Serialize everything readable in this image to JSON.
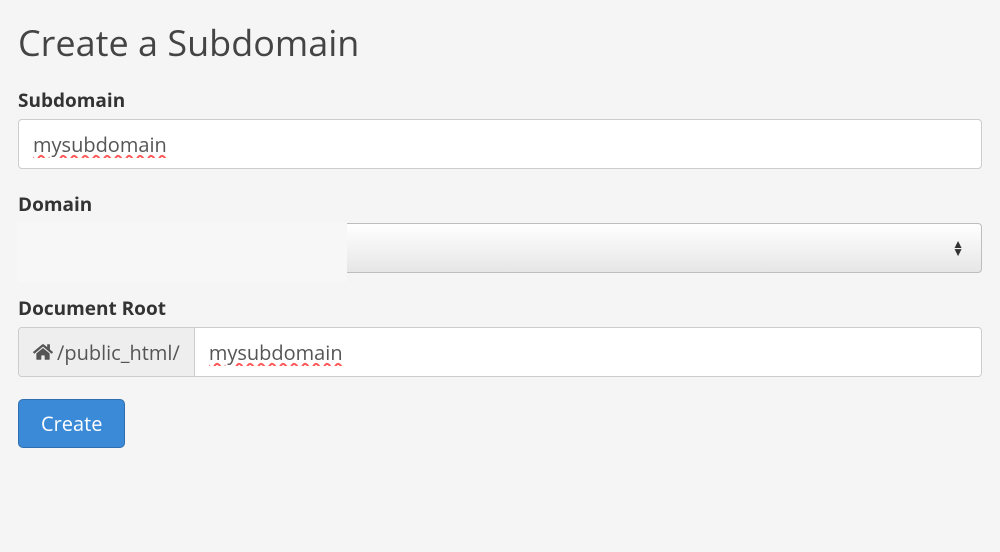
{
  "page": {
    "title": "Create a Subdomain"
  },
  "form": {
    "subdomain_label": "Subdomain",
    "subdomain_value": "mysubdomain",
    "domain_label": "Domain",
    "domain_selected": "",
    "docroot_label": "Document Root",
    "docroot_prefix": " /public_html/",
    "docroot_value": "mysubdomain",
    "submit_label": "Create"
  }
}
